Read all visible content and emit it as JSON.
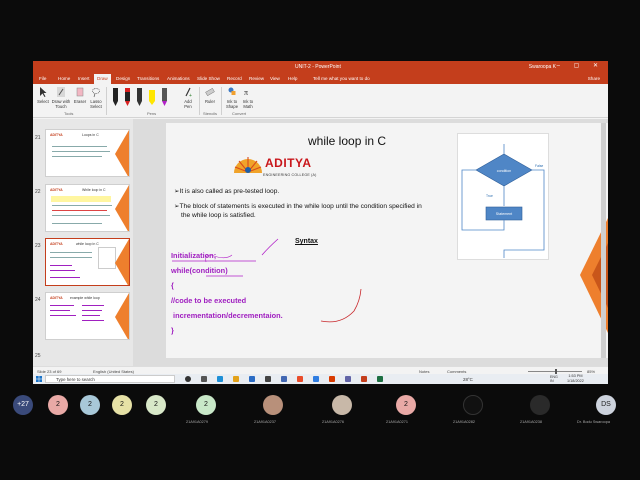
{
  "titlebar": {
    "doc_title": "UNIT-2 - PowerPoint",
    "search_hint": "Search",
    "user": "Swaroopa K",
    "window_controls": "– ▢ ✕"
  },
  "tabs": [
    "File",
    "Home",
    "Insert",
    "Draw",
    "Design",
    "Transitions",
    "Animations",
    "Slide Show",
    "Record",
    "Review",
    "View",
    "Help"
  ],
  "active_tab": "Draw",
  "tell_me": "Tell me what you want to do",
  "share": "Share",
  "ribbon": {
    "tools": [
      "Select",
      "Draw with Touch",
      "Eraser",
      "Lasso Select"
    ],
    "tools_group": "Tools",
    "pens_group": "Pens",
    "add_pen": "Add Pen",
    "ruler": "Ruler",
    "stencils_group": "Stencils",
    "ink_to_shape": "Ink to Shape",
    "ink_to_math": "Ink to Math",
    "convert_group": "Convert"
  },
  "thumbnails": [
    {
      "num": "21",
      "title": "Loops in C"
    },
    {
      "num": "22",
      "title": "While loop in C"
    },
    {
      "num": "23",
      "title": "while loop in C"
    },
    {
      "num": "24",
      "title": "example while loop"
    },
    {
      "num": "25",
      "title": ""
    }
  ],
  "slide": {
    "title": "while loop in C",
    "logo_name": "ADITYA",
    "logo_sub": "ENGINEERING COLLEGE (A)",
    "bullets": [
      "It is also called as pre-tested loop.",
      "The block of statements is executed in the while loop until the condition specified in the while loop is satisfied."
    ],
    "syntax_label": "Syntax",
    "code_lines": [
      "Initialization;",
      "while(condition)",
      "{",
      "//code to be executed",
      " incrementation/decrementaion.",
      "}"
    ],
    "flowchart": {
      "condition": "condition",
      "false_label": "False",
      "true_label": "True",
      "statement": "Statement"
    }
  },
  "statusbar": {
    "slide_info": "Slide 23 of 69",
    "language": "English (United States)",
    "notes": "Notes",
    "comments": "Comments",
    "zoom": "85%"
  },
  "taskbar": {
    "search_placeholder": "Type here to search",
    "weather": "28°C",
    "lang": "ENG IN",
    "time": "1:53 PM",
    "date": "1/18/2022"
  },
  "participants": [
    {
      "label": "+27",
      "name": ""
    },
    {
      "label": "2",
      "name": ""
    },
    {
      "label": "2",
      "name": ""
    },
    {
      "label": "2",
      "name": ""
    },
    {
      "label": "2",
      "name": ""
    },
    {
      "label": "2",
      "name": "21A91A0279"
    },
    {
      "label": "",
      "name": "21A91A0237"
    },
    {
      "label": "",
      "name": "21A91A0276"
    },
    {
      "label": "2",
      "name": "21A91A0271"
    },
    {
      "label": "",
      "name": "21A91A0282"
    },
    {
      "label": "",
      "name": "21A91A0238"
    },
    {
      "label": "DS",
      "name": "Dr. Bodu Swaroopa"
    }
  ],
  "colors": {
    "ppt_red": "#c43e1c",
    "code_purple": "#a020c0",
    "orange": "#ee7f2d",
    "flow_blue": "#4f86c6"
  }
}
